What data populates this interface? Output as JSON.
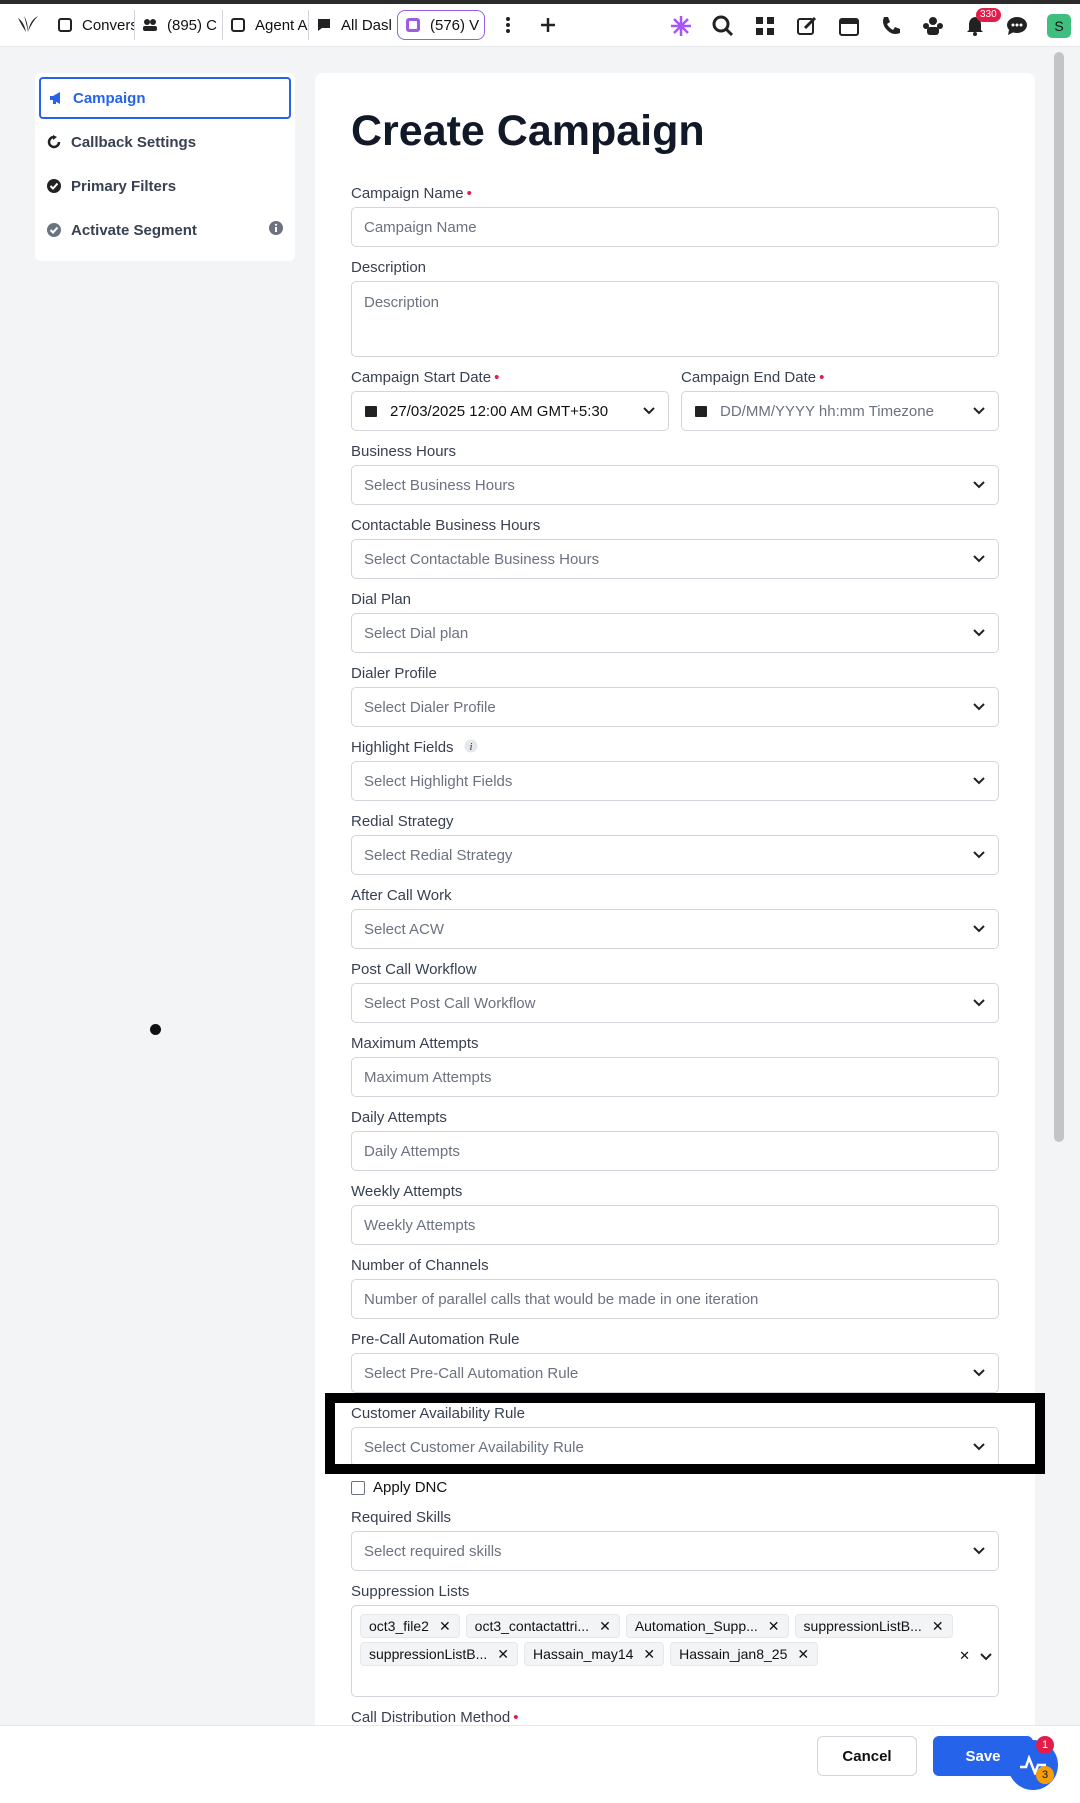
{
  "topbar": {
    "tabs": [
      {
        "label": "Convers"
      },
      {
        "label": "(895) C"
      },
      {
        "label": "Agent A"
      },
      {
        "label": "All Dash"
      },
      {
        "label": "(576) V"
      }
    ],
    "notification_count": "330",
    "avatar_letter": "S",
    "icons": [
      "sprinklr-logo",
      "more-icon",
      "plus-icon",
      "sparkle-icon",
      "search-icon",
      "grid-icon",
      "edit-icon",
      "calendar-icon",
      "phone-icon",
      "agents-icon",
      "bell-icon",
      "chat-icon"
    ]
  },
  "sidebar": {
    "items": [
      {
        "label": "Campaign"
      },
      {
        "label": "Callback Settings"
      },
      {
        "label": "Primary Filters"
      },
      {
        "label": "Activate Segment"
      }
    ]
  },
  "form": {
    "title": "Create Campaign",
    "campaign_name": {
      "label": "Campaign Name",
      "required": "•",
      "placeholder": "Campaign Name"
    },
    "description": {
      "label": "Description",
      "placeholder": "Description"
    },
    "start_date": {
      "label": "Campaign Start Date",
      "required": "•",
      "value": "27/03/2025 12:00 AM GMT+5:30"
    },
    "end_date": {
      "label": "Campaign End Date",
      "required": "•",
      "placeholder": "DD/MM/YYYY hh:mm Timezone"
    },
    "business_hours": {
      "label": "Business Hours",
      "placeholder": "Select Business Hours"
    },
    "contactable_hours": {
      "label": "Contactable Business Hours",
      "placeholder": "Select Contactable Business Hours"
    },
    "dial_plan": {
      "label": "Dial Plan",
      "placeholder": "Select Dial plan"
    },
    "dialer_profile": {
      "label": "Dialer Profile",
      "placeholder": "Select Dialer Profile"
    },
    "highlight_fields": {
      "label": "Highlight Fields",
      "placeholder": "Select Highlight Fields"
    },
    "redial_strategy": {
      "label": "Redial Strategy",
      "placeholder": "Select Redial Strategy"
    },
    "after_call_work": {
      "label": "After Call Work",
      "placeholder": "Select ACW"
    },
    "post_call_workflow": {
      "label": "Post Call Workflow",
      "placeholder": "Select Post Call Workflow"
    },
    "max_attempts": {
      "label": "Maximum Attempts",
      "placeholder": "Maximum Attempts"
    },
    "daily_attempts": {
      "label": "Daily Attempts",
      "placeholder": "Daily Attempts"
    },
    "weekly_attempts": {
      "label": "Weekly Attempts",
      "placeholder": "Weekly Attempts"
    },
    "num_channels": {
      "label": "Number of Channels",
      "placeholder": "Number of parallel calls that would be made in one iteration"
    },
    "pre_call_rule": {
      "label": "Pre-Call Automation Rule",
      "placeholder": "Select Pre-Call Automation Rule"
    },
    "customer_availability": {
      "label": "Customer Availability Rule",
      "placeholder": "Select Customer Availability Rule"
    },
    "apply_dnc": {
      "label": "Apply DNC",
      "checked": false
    },
    "required_skills": {
      "label": "Required Skills",
      "placeholder": "Select required skills"
    },
    "suppression_lists": {
      "label": "Suppression Lists",
      "chips": [
        "oct3_file2",
        "oct3_contactattri...",
        "Automation_Supp...",
        "suppressionListB...",
        "suppressionListB...",
        "Hassain_may14",
        "Hassain_jan8_25"
      ]
    },
    "call_distribution": {
      "label": "Call Distribution Method",
      "required": "•"
    }
  },
  "footer": {
    "cancel_label": "Cancel",
    "save_label": "Save",
    "fab_badge_top": "1",
    "fab_badge_bottom": "3"
  }
}
